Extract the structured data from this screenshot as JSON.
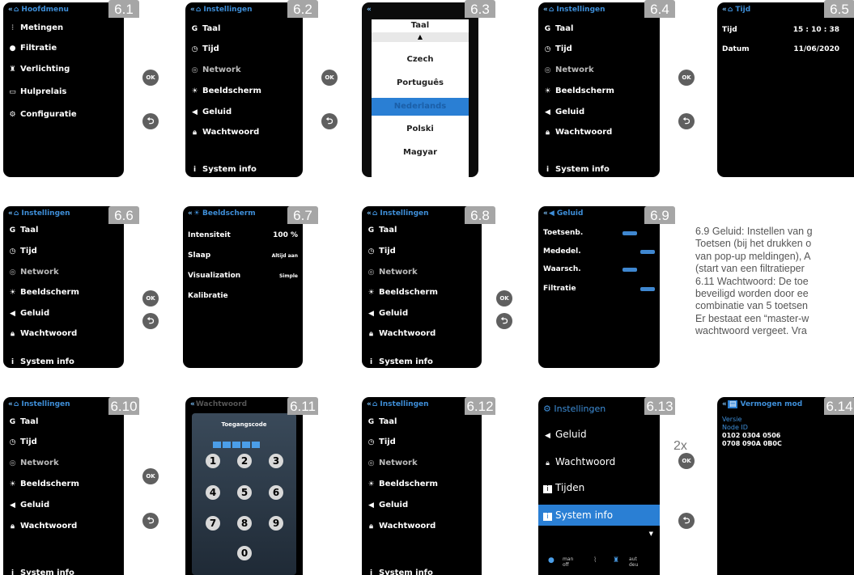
{
  "panels": {
    "p61": {
      "label": "6.1",
      "title": "Hoofdmenu",
      "items": [
        "Metingen",
        "Filtratie",
        "Verlichting",
        "Hulprelais",
        "Configuratie"
      ]
    },
    "p62": {
      "label": "6.2",
      "title": "Instellingen",
      "items": [
        "Taal",
        "Tijd",
        "Network",
        "Beeldscherm",
        "Geluid",
        "Wachtwoord",
        "System info"
      ]
    },
    "p63": {
      "label": "6.3",
      "title": "Taal",
      "items": [
        "Czech",
        "Português",
        "Nederlands",
        "Polski",
        "Magyar"
      ],
      "selected": "Nederlands"
    },
    "p64": {
      "label": "6.4",
      "title": "Instellingen",
      "items": [
        "Taal",
        "Tijd",
        "Network",
        "Beeldscherm",
        "Geluid",
        "Wachtwoord",
        "System info"
      ]
    },
    "p65": {
      "label": "6.5",
      "title": "Tijd",
      "rows": [
        {
          "k": "Tijd",
          "v": "15 : 10 : 38"
        },
        {
          "k": "Datum",
          "v": "11/06/2020"
        }
      ]
    },
    "p66": {
      "label": "6.6",
      "title": "Instellingen",
      "items": [
        "Taal",
        "Tijd",
        "Network",
        "Beeldscherm",
        "Geluid",
        "Wachtwoord",
        "System info"
      ]
    },
    "p67": {
      "label": "6.7",
      "title": "Beeldscherm",
      "rows": [
        {
          "k": "Intensiteit",
          "v": "100 %"
        },
        {
          "k": "Slaap",
          "v": "Altijd aan"
        },
        {
          "k": "Visualization",
          "v": "Simple"
        },
        {
          "k": "Kalibratie",
          "v": ""
        }
      ]
    },
    "p68": {
      "label": "6.8",
      "title": "Instellingen",
      "items": [
        "Taal",
        "Tijd",
        "Network",
        "Beeldscherm",
        "Geluid",
        "Wachtwoord",
        "System info"
      ]
    },
    "p69": {
      "label": "6.9",
      "title": "Geluid",
      "rows": [
        "Toetsenb.",
        "Mededel.",
        "Waarsch.",
        "Filtratie"
      ]
    },
    "p610": {
      "label": "6.10",
      "title": "Instellingen",
      "items": [
        "Taal",
        "Tijd",
        "Network",
        "Beeldscherm",
        "Geluid",
        "Wachtwoord",
        "System info"
      ]
    },
    "p611": {
      "label": "6.11",
      "title": "Wachtwoord",
      "prompt": "Toegangscode",
      "keys": [
        "1",
        "2",
        "3",
        "4",
        "5",
        "6",
        "7",
        "8",
        "9",
        "0"
      ]
    },
    "p612": {
      "label": "6.12",
      "title": "Instellingen",
      "items": [
        "Taal",
        "Tijd",
        "Network",
        "Beeldscherm",
        "Geluid",
        "Wachtwoord",
        "System info"
      ]
    },
    "p613": {
      "label": "6.13",
      "title": "Instellingen",
      "items": [
        "Geluid",
        "Wachtwoord",
        "Tijden",
        "System info"
      ],
      "footer": [
        "man off",
        "aut deu"
      ]
    },
    "p614": {
      "label": "6.14",
      "title": "Vermogen mod",
      "lines": [
        "Versie",
        "Node ID",
        "0102 0304 0506",
        "0708 090A 0B0C"
      ]
    }
  },
  "buttons": {
    "ok": "OK",
    "back": "⮌",
    "repeat": "2x"
  },
  "description": [
    "6.9 Geluid: Instellen van g",
    "Toetsen (bij het drukken o",
    "van pop-up meldingen), A",
    "(start van een filtratieper",
    "6.11 Wachtwoord: De toe",
    "beveiligd worden door ee",
    "combinatie van 5 toetsen",
    "Er bestaat een “master-w",
    "wachtwoord vergeet. Vra"
  ],
  "colors": {
    "accent": "#3e8ed8",
    "highlight": "#2a7fd4",
    "tag": "#a6a6a6",
    "button": "#5f5f5f"
  }
}
